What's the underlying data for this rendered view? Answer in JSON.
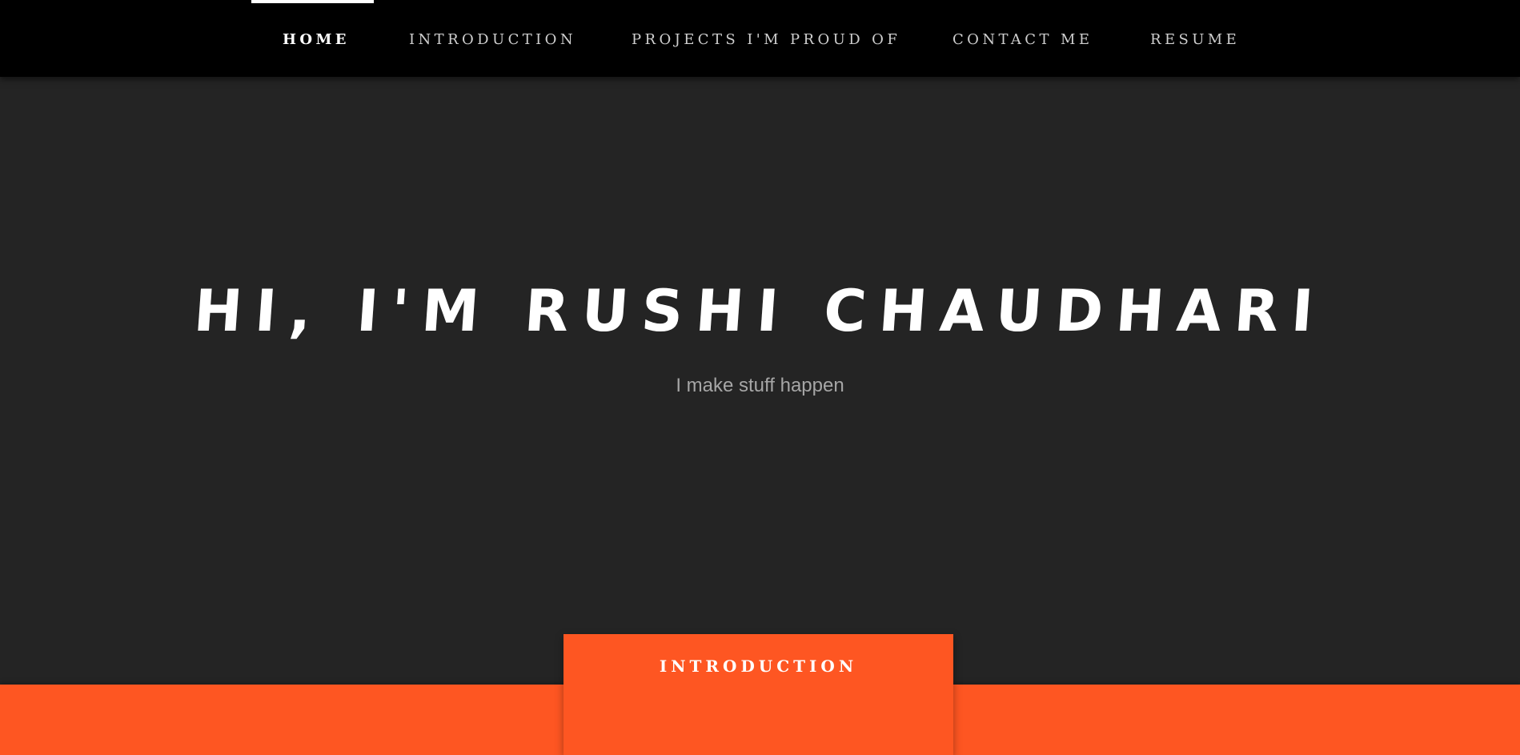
{
  "nav": {
    "items": [
      {
        "label": "HOME",
        "active": true
      },
      {
        "label": "INTRODUCTION",
        "active": false
      },
      {
        "label": "PROJECTS I'M PROUD OF",
        "active": false
      },
      {
        "label": "CONTACT ME",
        "active": false
      },
      {
        "label": "RESUME",
        "active": false
      }
    ]
  },
  "hero": {
    "title": "HI, I'M RUSHI CHAUDHARI",
    "subtitle": "I make stuff happen"
  },
  "section_tab": {
    "label": "INTRODUCTION"
  },
  "colors": {
    "navbar": "#000000",
    "hero_background": "#242424",
    "accent": "#fe5622",
    "title": "#ffffff",
    "subtitle": "#a6a6a6"
  }
}
